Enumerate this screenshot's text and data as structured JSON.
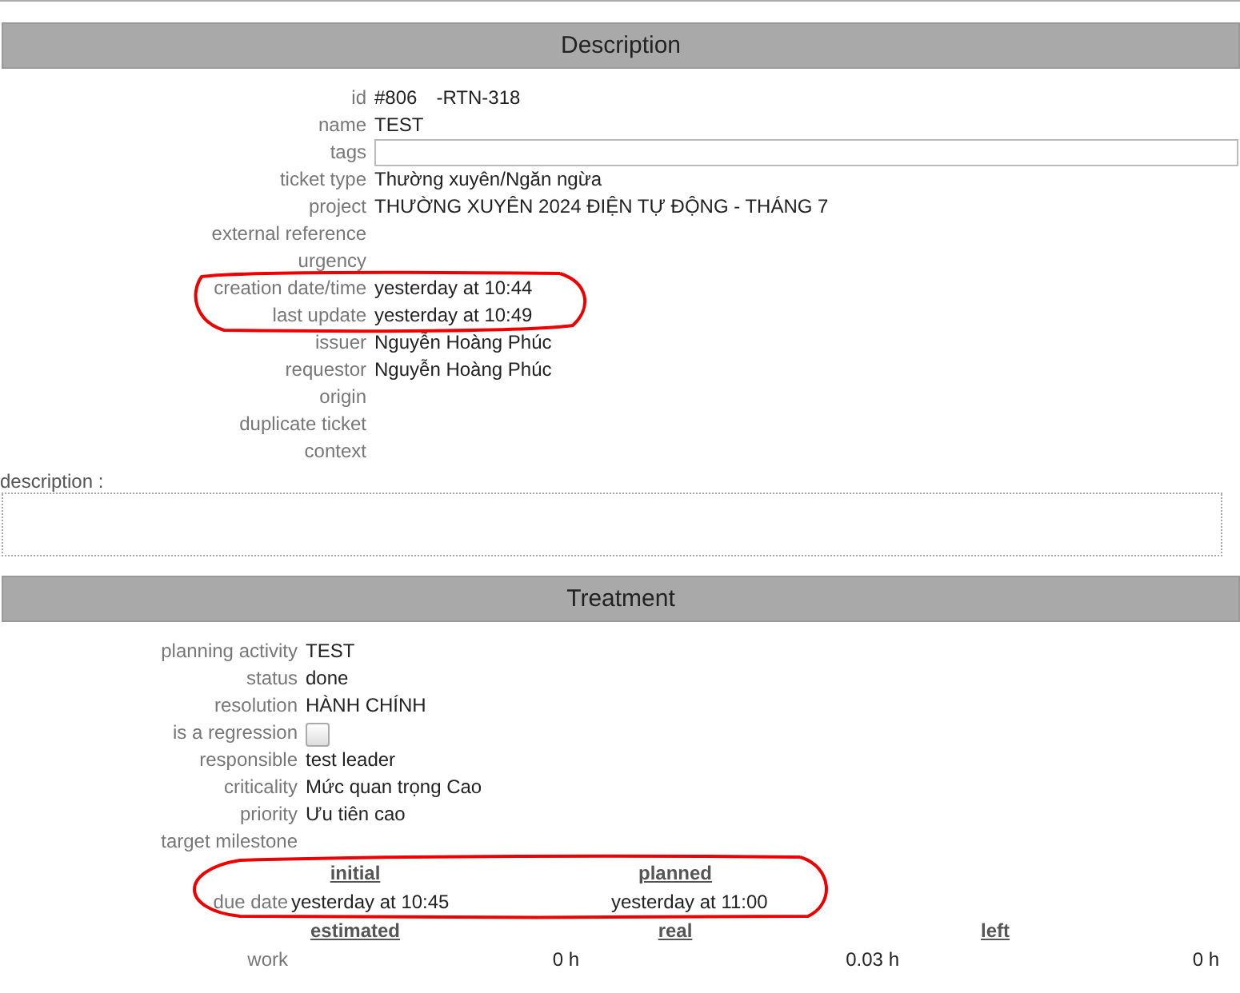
{
  "description_section": {
    "title": "Description",
    "fields": [
      {
        "label": "id",
        "kind": "id",
        "value": "#806",
        "extra": "-RTN-318"
      },
      {
        "label": "name",
        "kind": "text",
        "value": "TEST"
      },
      {
        "label": "tags",
        "kind": "input"
      },
      {
        "label": "ticket type",
        "kind": "text",
        "value": "Thường xuyên/Ngăn ngừa"
      },
      {
        "label": "project",
        "kind": "text",
        "value": "THƯỜNG XUYÊN 2024 ĐIỆN TỰ ĐỘNG - THÁNG 7"
      },
      {
        "label": "external reference",
        "kind": "text"
      },
      {
        "label": "urgency",
        "kind": "text"
      },
      {
        "label": "creation date/time",
        "kind": "text",
        "value": "yesterday at 10:44"
      },
      {
        "label": "last update",
        "kind": "text",
        "value": "yesterday at 10:49"
      },
      {
        "label": "issuer",
        "kind": "text",
        "value": "Nguyễn Hoàng Phúc"
      },
      {
        "label": "requestor",
        "kind": "text",
        "value": "Nguyễn Hoàng Phúc"
      },
      {
        "label": "origin",
        "kind": "text"
      },
      {
        "label": "duplicate ticket",
        "kind": "text"
      },
      {
        "label": "context",
        "kind": "text"
      }
    ],
    "description_label": "description :"
  },
  "treatment_section": {
    "title": "Treatment",
    "fields": [
      {
        "label": "planning activity",
        "kind": "text",
        "value": "TEST"
      },
      {
        "label": "status",
        "kind": "text",
        "value": "done"
      },
      {
        "label": "resolution",
        "kind": "text",
        "value": "HÀNH CHÍNH"
      },
      {
        "label": "is a regression",
        "kind": "checkbox",
        "checked": false
      },
      {
        "label": "responsible",
        "kind": "text",
        "value": "test leader"
      },
      {
        "label": "criticality",
        "kind": "text",
        "value": "Mức quan trọng Cao"
      },
      {
        "label": "priority",
        "kind": "text",
        "value": "Ưu tiên cao"
      },
      {
        "label": "target milestone",
        "kind": "text"
      }
    ],
    "dates": {
      "headers": [
        "initial",
        "planned"
      ],
      "label": "due date",
      "values": [
        "yesterday at 10:45",
        "yesterday at 11:00"
      ]
    },
    "work": {
      "headers": [
        "estimated",
        "real",
        "left"
      ],
      "label": "work",
      "values": [
        "0 h",
        "0.03 h",
        "0 h"
      ]
    }
  }
}
